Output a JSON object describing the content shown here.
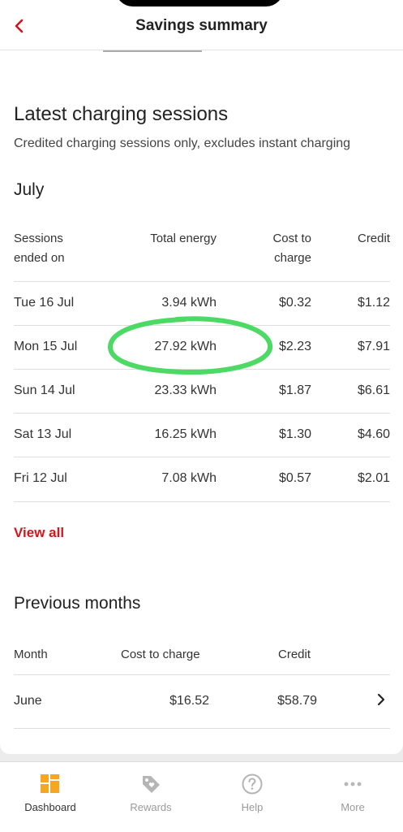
{
  "header": {
    "title": "Savings summary"
  },
  "latest": {
    "title": "Latest charging sessions",
    "subtitle": "Credited charging sessions only, excludes instant charging",
    "month": "July",
    "columns": {
      "sessions_line1": "Sessions",
      "sessions_line2": "ended on",
      "energy": "Total energy",
      "cost_line1": "Cost to",
      "cost_line2": "charge",
      "credit": "Credit"
    },
    "rows": [
      {
        "date": "Tue 16 Jul",
        "energy": "3.94 kWh",
        "cost": "$0.32",
        "credit": "$1.12"
      },
      {
        "date": "Mon 15 Jul",
        "energy": "27.92 kWh",
        "cost": "$2.23",
        "credit": "$7.91"
      },
      {
        "date": "Sun 14 Jul",
        "energy": "23.33 kWh",
        "cost": "$1.87",
        "credit": "$6.61"
      },
      {
        "date": "Sat 13 Jul",
        "energy": "16.25 kWh",
        "cost": "$1.30",
        "credit": "$4.60"
      },
      {
        "date": "Fri 12 Jul",
        "energy": "7.08 kWh",
        "cost": "$0.57",
        "credit": "$2.01"
      }
    ],
    "view_all": "View all"
  },
  "previous": {
    "title": "Previous months",
    "columns": {
      "month": "Month",
      "cost": "Cost to charge",
      "credit": "Credit"
    },
    "rows": [
      {
        "month": "June",
        "cost": "$16.52",
        "credit": "$58.79"
      }
    ]
  },
  "nav": {
    "items": [
      {
        "label": "Dashboard",
        "icon": "dashboard-icon",
        "active": true
      },
      {
        "label": "Rewards",
        "icon": "rewards-tag-icon",
        "active": false
      },
      {
        "label": "Help",
        "icon": "help-icon",
        "active": false
      },
      {
        "label": "More",
        "icon": "more-dots-icon",
        "active": false
      }
    ]
  },
  "colors": {
    "accent": "#d3161c",
    "dashboard_icon": "#f5a623",
    "highlight": "#4cd964"
  }
}
